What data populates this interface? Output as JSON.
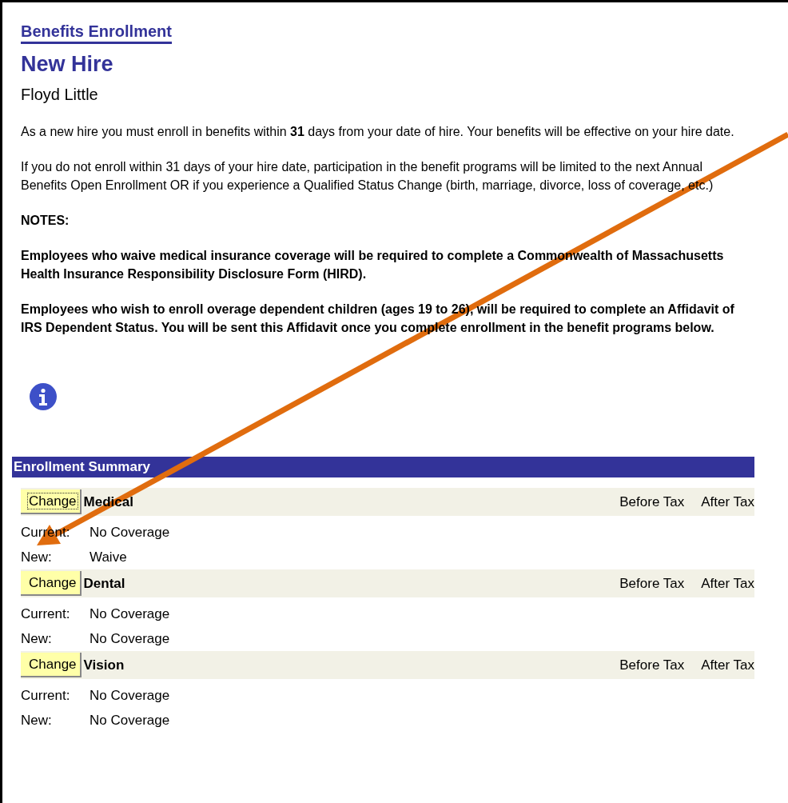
{
  "breadcrumb": "Benefits Enrollment",
  "title": "New Hire",
  "employee": "Floyd Little",
  "paragraphs": [
    {
      "text": "As a new hire you must enroll in benefits within **31** days from your date of hire. Your benefits will be effective on your hire date.",
      "bold": false
    },
    {
      "text": "If you do not enroll within 31 days of your hire date, participation in the benefit programs will be limited to the next Annual Benefits Open Enrollment OR if you experience a Qualified Status Change (birth, marriage, divorce, loss of coverage, etc.)",
      "bold": false
    },
    {
      "text": "NOTES:",
      "bold": true
    },
    {
      "text": "Employees who waive medical insurance coverage will be required to complete a Commonwealth of Massachusetts Health Insurance Responsibility Disclosure Form (HIRD).",
      "bold": true
    },
    {
      "text": "Employees who wish to enroll overage dependent children (ages 19 to 26), will be required to complete an Affidavit of IRS Dependent Status. You will be sent this Affidavit once you complete enrollment in the benefit programs below.",
      "bold": true
    }
  ],
  "summary": {
    "title": "Enrollment Summary",
    "plans": [
      {
        "button": "Change",
        "focused": true,
        "name": "Medical",
        "before_tax": "Before Tax",
        "after_tax": "After Tax",
        "current_label": "Current:",
        "current": "No Coverage",
        "new_label": "New:",
        "new": "Waive"
      },
      {
        "button": "Change",
        "focused": false,
        "name": "Dental",
        "before_tax": "Before Tax",
        "after_tax": "After Tax",
        "current_label": "Current:",
        "current": "No Coverage",
        "new_label": "New:",
        "new": "No Coverage"
      },
      {
        "button": "Change",
        "focused": false,
        "name": "Vision",
        "before_tax": "Before Tax",
        "after_tax": "After Tax",
        "current_label": "Current:",
        "current": "No Coverage",
        "new_label": "New:",
        "new": "No Coverage"
      }
    ]
  }
}
